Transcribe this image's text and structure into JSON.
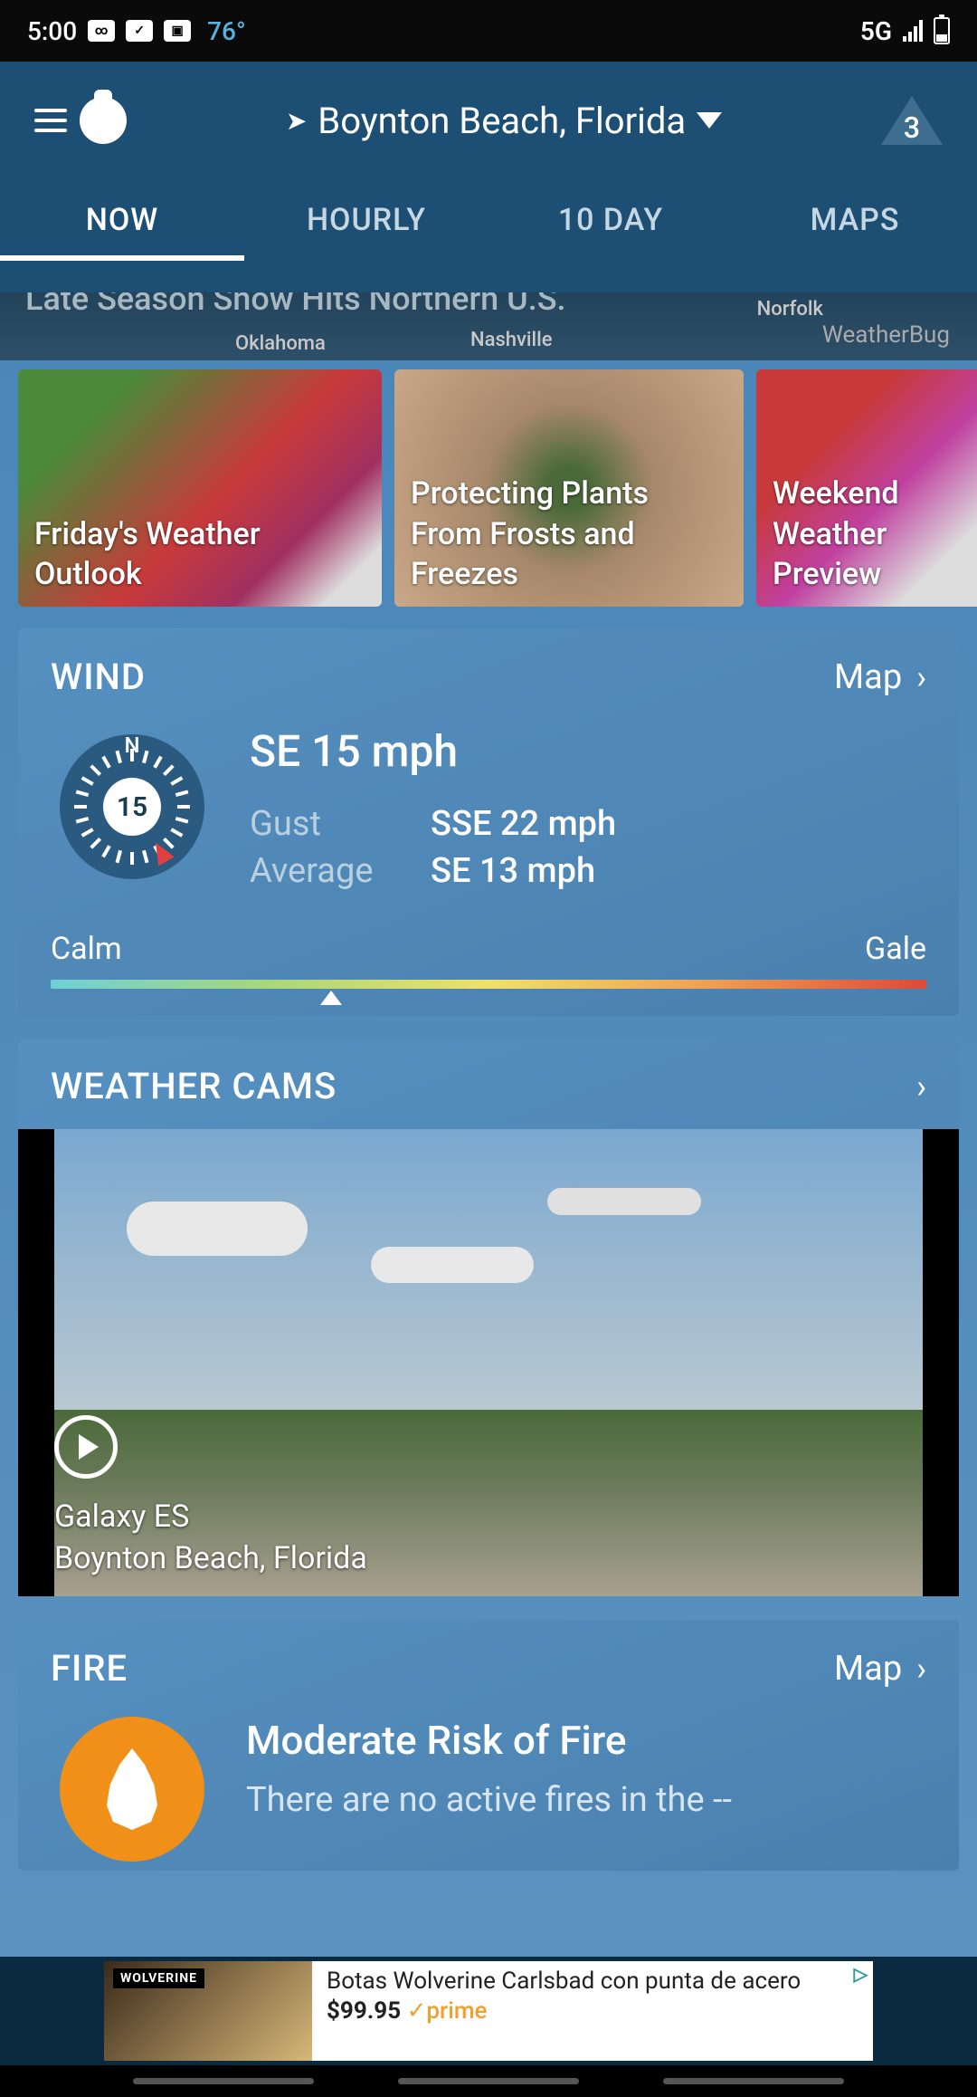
{
  "status_bar": {
    "time": "5:00",
    "temp": "76°",
    "network": "5G"
  },
  "header": {
    "location": "Boynton Beach, Florida",
    "alert_count": "3"
  },
  "tabs": [
    "NOW",
    "HOURLY",
    "10 DAY",
    "MAPS"
  ],
  "news_banner": {
    "headline": "Late Season Snow Hits Northern U.S.",
    "watermark": "WeatherBug",
    "city1": "Nashville",
    "city2": "Norfolk",
    "city3": "Oklahoma"
  },
  "stories": [
    {
      "title": "Friday's Weather Outlook"
    },
    {
      "title": "Protecting Plants From Frosts and Freezes"
    },
    {
      "title": "Weekend Weather Preview"
    }
  ],
  "wind": {
    "title": "WIND",
    "link": "Map",
    "compass_n": "N",
    "compass_value": "15",
    "main": "SE 15 mph",
    "gust_label": "Gust",
    "gust_value": "SSE 22 mph",
    "avg_label": "Average",
    "avg_value": "SE 13 mph",
    "scale_low": "Calm",
    "scale_high": "Gale"
  },
  "cams": {
    "title": "WEATHER CAMS",
    "name": "Galaxy ES",
    "location": "Boynton Beach, Florida"
  },
  "fire": {
    "title": "FIRE",
    "link": "Map",
    "risk": "Moderate Risk of Fire",
    "desc": "There are no active fires in the --"
  },
  "ad": {
    "brand": "WOLVERINE",
    "text": "Botas Wolverine Carlsbad con punta de acero",
    "price": "$99.95",
    "prime": "prime"
  }
}
